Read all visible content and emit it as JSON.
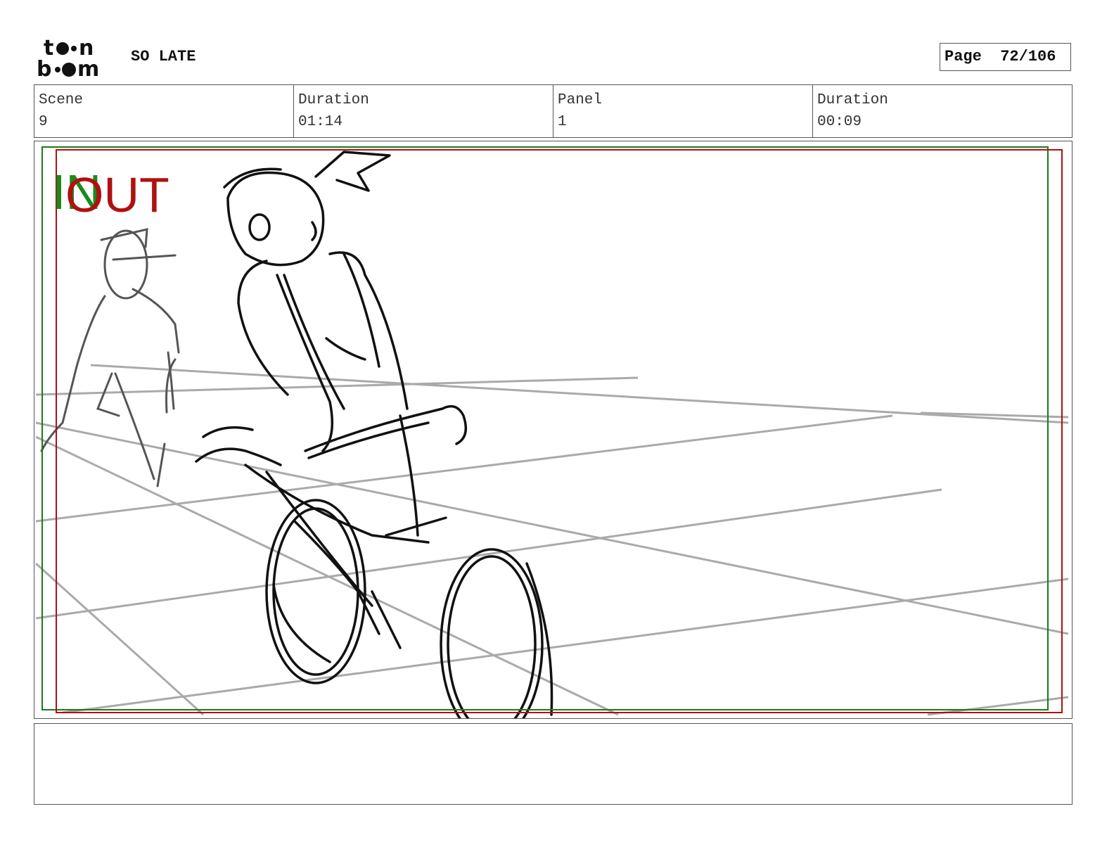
{
  "header": {
    "logo_text_line1": "toon",
    "logo_text_line2": "boom",
    "project_title": "SO LATE",
    "page_label": "Page",
    "page_number": "72/106"
  },
  "info": {
    "scene_label": "Scene",
    "scene_value": "9",
    "scene_duration_label": "Duration",
    "scene_duration_value": "01:14",
    "panel_label": "Panel",
    "panel_value": "1",
    "panel_duration_label": "Duration",
    "panel_duration_value": "00:09"
  },
  "panel": {
    "in_marker": "IN",
    "out_marker": "OUT",
    "in_color": "#1a8a1a",
    "out_color": "#b01010",
    "description": ""
  },
  "notes": {
    "text": ""
  }
}
